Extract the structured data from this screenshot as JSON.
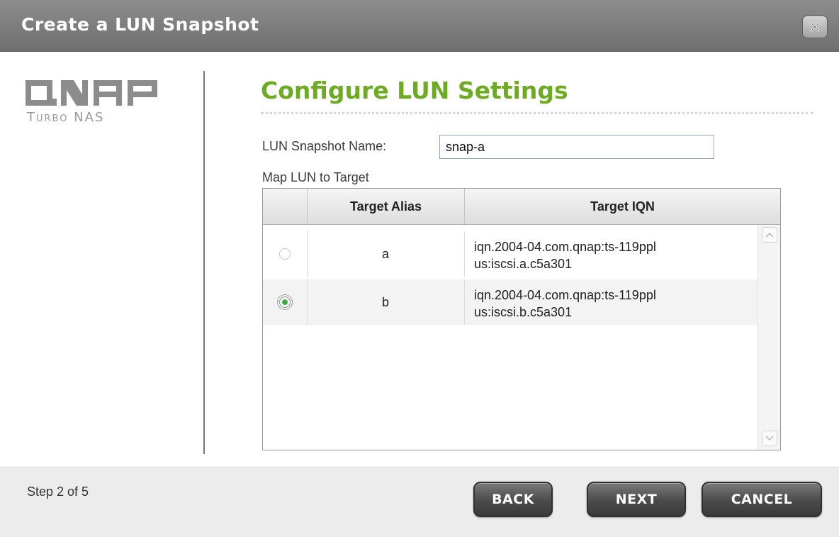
{
  "window": {
    "title": "Create a LUN Snapshot",
    "close_icon": "close-icon"
  },
  "brand": {
    "logo_text": "QNAP",
    "subtitle": "Turbo NAS"
  },
  "main": {
    "title": "Configure LUN Settings",
    "snapshot_name_label": "LUN Snapshot Name:",
    "snapshot_name_value": "snap-a",
    "map_label": "Map LUN to Target"
  },
  "targets_table": {
    "columns": [
      "",
      "Target Alias",
      "Target IQN"
    ],
    "rows": [
      {
        "selected": false,
        "alias": "a",
        "iqn_line1": "iqn.2004-04.com.qnap:ts-119ppl",
        "iqn_line2": "us:iscsi.a.c5a301"
      },
      {
        "selected": true,
        "alias": "b",
        "iqn_line1": "iqn.2004-04.com.qnap:ts-119ppl",
        "iqn_line2": "us:iscsi.b.c5a301"
      }
    ]
  },
  "footer": {
    "step": "Step 2 of 5",
    "back_label": "BACK",
    "next_label": "NEXT",
    "cancel_label": "CANCEL"
  },
  "colors": {
    "accent": "#6cab22",
    "titlebar": "#7d7d7d",
    "button": "#4a4a4a"
  }
}
